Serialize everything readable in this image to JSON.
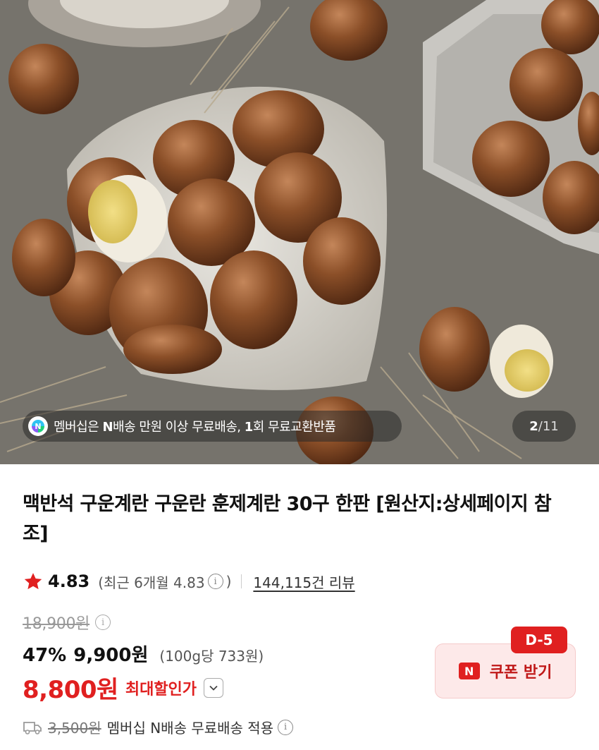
{
  "hero": {
    "promo_prefix": "멤버십은 ",
    "promo_bold1": "N",
    "promo_mid": "배송 만원 이상 무료배송, ",
    "promo_bold2": "1",
    "promo_suffix": "회 무료교환반품",
    "counter_current": "2",
    "counter_sep": "/",
    "counter_total": "11",
    "membership_icon_letter": "N"
  },
  "product": {
    "title": "맥반석 구운계란 구운란 훈제계란 30구 한판 [원산지:상세페이지 참조]"
  },
  "rating": {
    "score": "4.83",
    "recent_text": "(최근 6개월 4.83",
    "recent_close": ")",
    "review_link": "144,115건 리뷰",
    "info_glyph": "i"
  },
  "price": {
    "original": "18,900원",
    "discount": "47%",
    "sale": "9,900원",
    "unit": "(100g당 733원)",
    "max": "8,800원",
    "max_label": "최대할인가"
  },
  "shipping": {
    "original_fee": "3,500원",
    "text": "멤버십 N배송 무료배송 적용"
  },
  "coupon": {
    "dday": "D-5",
    "badge": "N",
    "label": "쿠폰 받기"
  },
  "colors": {
    "accent_red": "#e02020",
    "coupon_bg": "#fde9e9"
  },
  "icons": [
    "membership-n-icon",
    "star-icon",
    "info-icon",
    "chevron-down-icon",
    "truck-icon"
  ]
}
